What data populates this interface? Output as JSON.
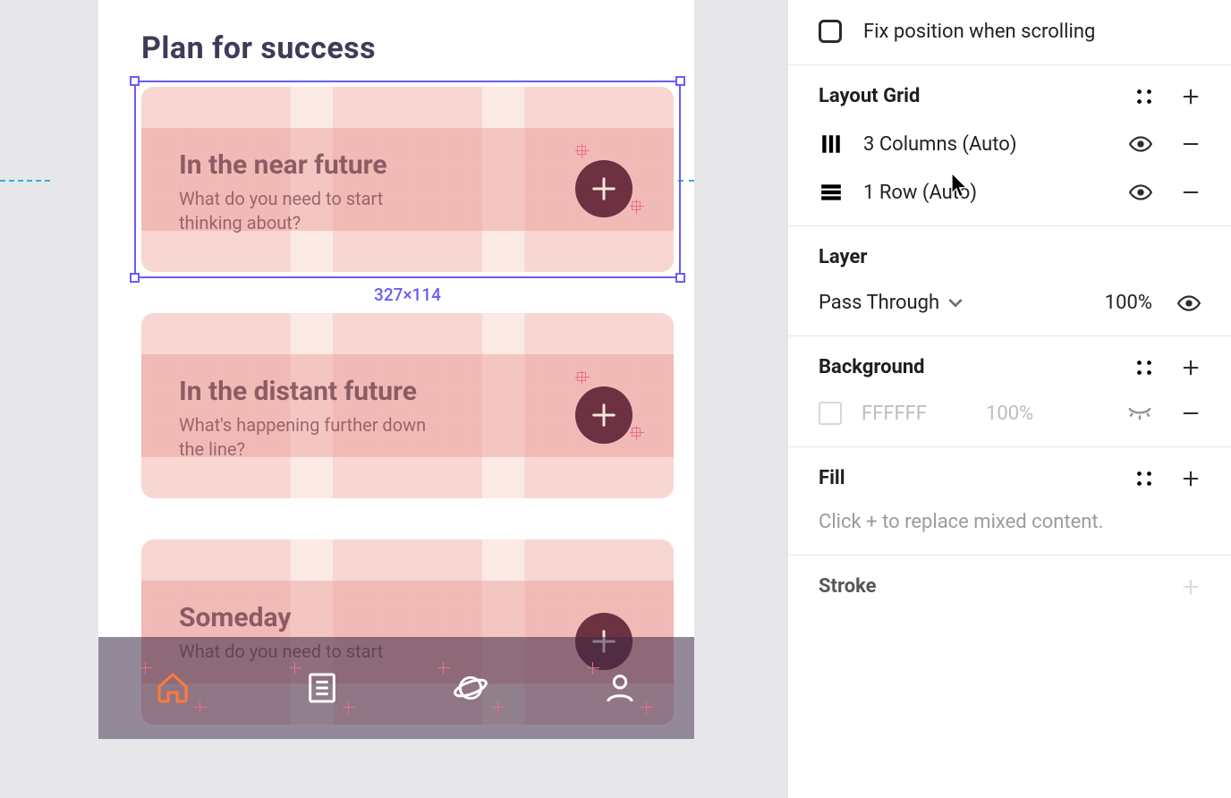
{
  "canvas": {
    "title": "Plan for success",
    "selection_size": "327×114",
    "cards": [
      {
        "heading": "In the near future",
        "sub": "What do you need to start thinking about?"
      },
      {
        "heading": "In the distant future",
        "sub": "What's happening further down the line?"
      },
      {
        "heading": "Someday",
        "sub": "What do you need to start"
      }
    ]
  },
  "inspector": {
    "fix_position": "Fix position when scrolling",
    "layout_grid": {
      "title": "Layout Grid",
      "items": [
        {
          "label": "3 Columns (Auto)"
        },
        {
          "label": "1 Row (Auto)"
        }
      ]
    },
    "layer": {
      "title": "Layer",
      "blend": "Pass Through",
      "opacity": "100%"
    },
    "background": {
      "title": "Background",
      "hex": "FFFFFF",
      "opacity": "100%"
    },
    "fill": {
      "title": "Fill",
      "hint": "Click + to replace mixed content."
    },
    "stroke": {
      "title": "Stroke"
    }
  }
}
